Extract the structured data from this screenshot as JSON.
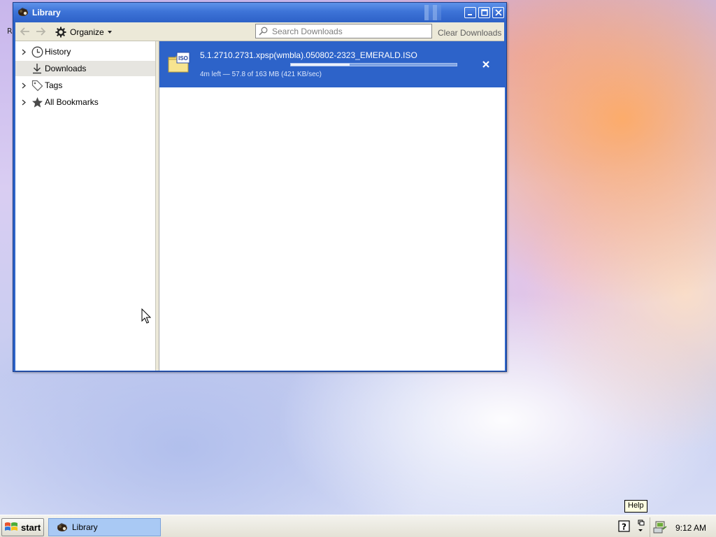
{
  "desktop": {
    "fragment": "R"
  },
  "window": {
    "title": "Library",
    "icon": "library-app-icon",
    "controls": [
      "minimize-icon",
      "maximize-icon",
      "close-icon"
    ]
  },
  "toolbar": {
    "back_icon": "back-arrow-icon",
    "forward_icon": "forward-arrow-icon",
    "organize_label": "Organize",
    "search_placeholder": "Search Downloads",
    "clear_label": "Clear Downloads"
  },
  "sidebar": {
    "items": [
      {
        "label": "History",
        "icon": "clock-icon",
        "expandable": true,
        "selected": false
      },
      {
        "label": "Downloads",
        "icon": "download-icon",
        "expandable": false,
        "selected": true
      },
      {
        "label": "Tags",
        "icon": "tag-icon",
        "expandable": true,
        "selected": false
      },
      {
        "label": "All Bookmarks",
        "icon": "star-icon",
        "expandable": true,
        "selected": false
      }
    ]
  },
  "downloads": [
    {
      "filename": "5.1.2710.2731.xpsp(wmbla).050802-2323_EMERALD.ISO",
      "status": "4m left — 57.8 of 163 MB (421 KB/sec)",
      "progress": 0.355,
      "file_icon": "iso-file-icon",
      "icon_text": "ISO"
    }
  ],
  "tooltip": {
    "text": "Help"
  },
  "taskbar": {
    "start_label": "start",
    "task_label": "Library",
    "clock": "9:12 AM"
  },
  "colors": {
    "accent": "#2d63c9",
    "toolbar_bg": "#ece9d8",
    "selection_bg": "#e6e5e0"
  }
}
